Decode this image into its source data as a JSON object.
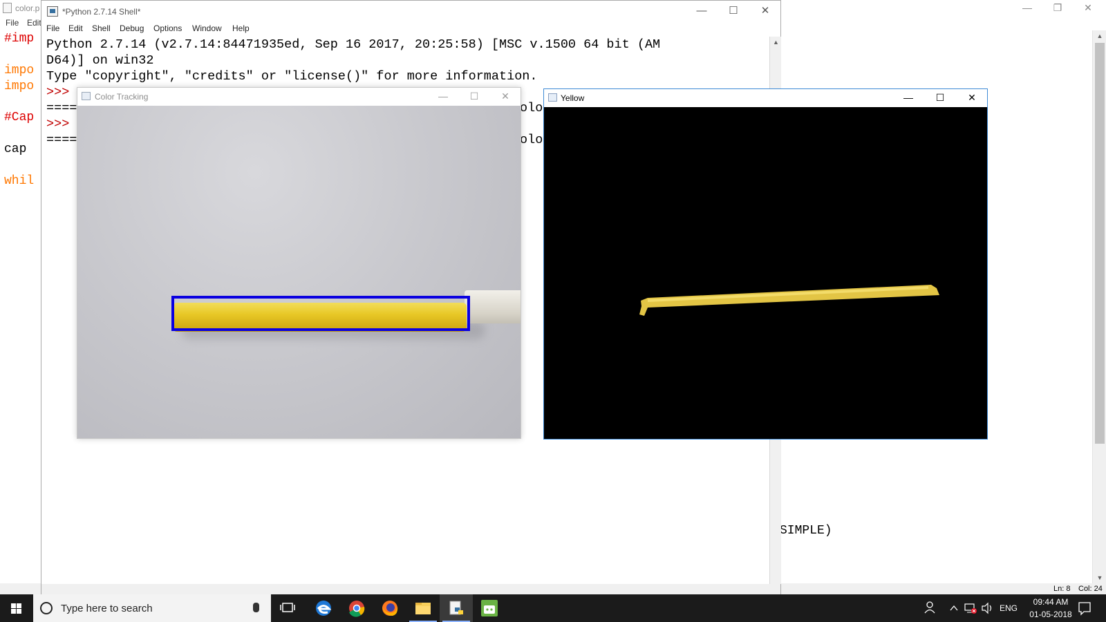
{
  "bg_editor": {
    "title": "color.p",
    "menu": [
      "File",
      "Edit"
    ],
    "code_lines": [
      "#imp",
      "impo",
      "impo",
      "#Cap",
      "cap ",
      "whil"
    ],
    "fragment_simple": "SIMPLE)",
    "status_line": "Ln: 8",
    "status_col": "Col: 24",
    "caption": {
      "minimize": "—",
      "restore": "❐",
      "close": "✕"
    }
  },
  "shell": {
    "title": "*Python 2.7.14 Shell*",
    "menu": [
      "File",
      "Edit",
      "Shell",
      "Debug",
      "Options",
      "Window",
      "Help"
    ],
    "lines": [
      "Python 2.7.14 (v2.7.14:84471935ed, Sep 16 2017, 20:25:58) [MSC v.1500 64 bit (AM",
      "D64)] on win32",
      "Type \"copyright\", \"credits\" or \"license()\" for more information."
    ],
    "prompt": ">>>",
    "restart_prefix": "====",
    "restart_suffix": "olo",
    "caption": {
      "minimize": "—",
      "maximize": "☐",
      "close": "✕"
    }
  },
  "color_tracking": {
    "title": "Color Tracking",
    "caption": {
      "minimize": "—",
      "maximize": "☐",
      "close": "✕"
    }
  },
  "yellow": {
    "title": "Yellow",
    "caption": {
      "minimize": "—",
      "maximize": "☐",
      "close": "✕"
    }
  },
  "taskbar": {
    "search_placeholder": "Type here to search",
    "language": "ENG",
    "time": "09:44 AM",
    "date": "01-05-2018",
    "apps": [
      "task-view",
      "edge",
      "chrome",
      "firefox",
      "file-explorer",
      "python-idle",
      "android-studio"
    ]
  },
  "colors": {
    "prompt_red": "#c00000",
    "keyword_orange": "#ff7700",
    "comment_red": "#dd0000",
    "bbox_blue": "#0a00e0",
    "marker_yellow": "#e8c826",
    "taskbar_bg": "#1b1b1b"
  }
}
